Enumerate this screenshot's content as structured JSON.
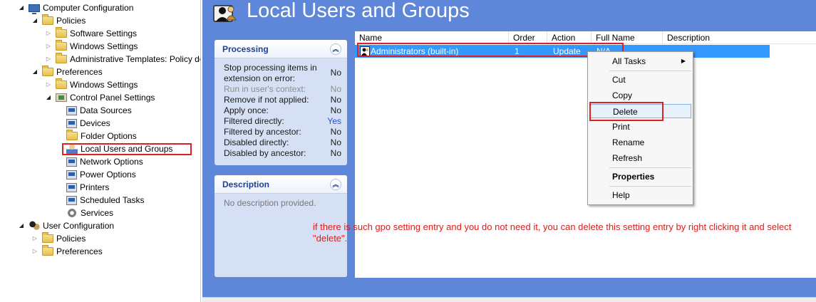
{
  "tree": {
    "items": [
      {
        "label": "Computer Configuration",
        "icon": "computer-icon",
        "expanded": true
      },
      {
        "label": "Policies",
        "icon": "folder-icon",
        "expanded": true
      },
      {
        "label": "Software Settings",
        "icon": "folder-icon",
        "expanded": false
      },
      {
        "label": "Windows Settings",
        "icon": "folder-icon",
        "expanded": false
      },
      {
        "label": "Administrative Templates: Policy de",
        "icon": "folder-icon",
        "expanded": false
      },
      {
        "label": "Preferences",
        "icon": "folder-icon",
        "expanded": true
      },
      {
        "label": "Windows Settings",
        "icon": "folder-icon",
        "expanded": false
      },
      {
        "label": "Control Panel Settings",
        "icon": "control-panel-icon",
        "expanded": true
      },
      {
        "label": "Data Sources",
        "icon": "data-sources-icon"
      },
      {
        "label": "Devices",
        "icon": "devices-icon"
      },
      {
        "label": "Folder Options",
        "icon": "folder-options-icon"
      },
      {
        "label": "Local Users and Groups",
        "icon": "local-users-icon",
        "selected": true
      },
      {
        "label": "Network Options",
        "icon": "network-options-icon"
      },
      {
        "label": "Power Options",
        "icon": "power-options-icon"
      },
      {
        "label": "Printers",
        "icon": "printers-icon"
      },
      {
        "label": "Scheduled Tasks",
        "icon": "scheduled-tasks-icon"
      },
      {
        "label": "Services",
        "icon": "services-icon"
      },
      {
        "label": "User Configuration",
        "icon": "user-config-icon",
        "expanded": true
      },
      {
        "label": "Policies",
        "icon": "folder-icon",
        "expanded": false
      },
      {
        "label": "Preferences",
        "icon": "folder-icon",
        "expanded": false
      }
    ]
  },
  "header": {
    "title": "Local Users and Groups"
  },
  "processing": {
    "title": "Processing",
    "rows": [
      {
        "k": "Stop processing items in extension on error:",
        "v": "No"
      },
      {
        "k": "Run in user's context:",
        "v": "No",
        "dim": true
      },
      {
        "k": "Remove if not applied:",
        "v": "No"
      },
      {
        "k": "Apply once:",
        "v": "No"
      },
      {
        "k": "Filtered directly:",
        "v": "Yes",
        "blue": true
      },
      {
        "k": "Filtered by ancestor:",
        "v": "No"
      },
      {
        "k": "Disabled directly:",
        "v": "No"
      },
      {
        "k": "Disabled by ancestor:",
        "v": "No"
      }
    ]
  },
  "description": {
    "title": "Description",
    "text": "No description provided."
  },
  "table": {
    "columns": [
      "Name",
      "Order",
      "Action",
      "Full Name",
      "Description"
    ],
    "rows": [
      {
        "name": "Administrators (built-in)",
        "order": "1",
        "action": "Update",
        "fullname": "N/A",
        "description": ""
      }
    ]
  },
  "context_menu": {
    "all_tasks": "All Tasks",
    "cut": "Cut",
    "copy": "Copy",
    "delete": "Delete",
    "print": "Print",
    "rename": "Rename",
    "refresh": "Refresh",
    "properties": "Properties",
    "help": "Help"
  },
  "annotation": "if there is such gpo setting entry and you do not need it, you can delete this setting entry by right clicking it and select \"delete\".",
  "colors": {
    "pane_bg": "#5f87d9",
    "selection": "#3399ff",
    "highlight_box": "#e02020",
    "annotation": "#e01b1b"
  }
}
